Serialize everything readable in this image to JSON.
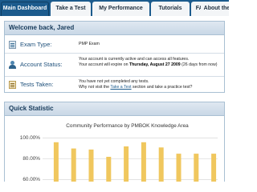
{
  "nav": {
    "tabs": [
      {
        "label": "Main Dashboard",
        "active": true
      },
      {
        "label": "Take a Test",
        "active": false
      },
      {
        "label": "My Performance",
        "active": false
      },
      {
        "label": "Tutorials",
        "active": false
      },
      {
        "label": "FAQ",
        "active": false
      },
      {
        "label": "About the",
        "active": false
      }
    ]
  },
  "welcome": {
    "title": "Welcome back, Jared",
    "rows": [
      {
        "icon": "exam-icon",
        "label": "Exam Type:",
        "lines": [
          "PMP Exam"
        ]
      },
      {
        "icon": "account-icon",
        "label": "Account Status:",
        "lines": [
          "Your account is currently active and can access all features.",
          "Your account will expire on ",
          "Thursday, August 27 2009",
          " (26 days from now)"
        ]
      },
      {
        "icon": "tests-icon",
        "label": "Tests Taken:",
        "lines": [
          "You have not yet completed any tests.",
          "Why not visit the ",
          "Take a Test",
          " section and take a practice test?"
        ]
      }
    ]
  },
  "stats": {
    "title": "Quick Statistic"
  },
  "chart_data": {
    "type": "bar",
    "title": "Community Performance by PMBOK Knowledge Area",
    "ylim": [
      55,
      102
    ],
    "yticks": [
      "100.00%",
      "80.00%",
      "60.00%"
    ],
    "ytick_values": [
      100,
      80,
      60
    ],
    "grid": true,
    "bar_color": "#f0c75e",
    "values": [
      96,
      90,
      89,
      82,
      92,
      96,
      91,
      85,
      85,
      85
    ]
  }
}
